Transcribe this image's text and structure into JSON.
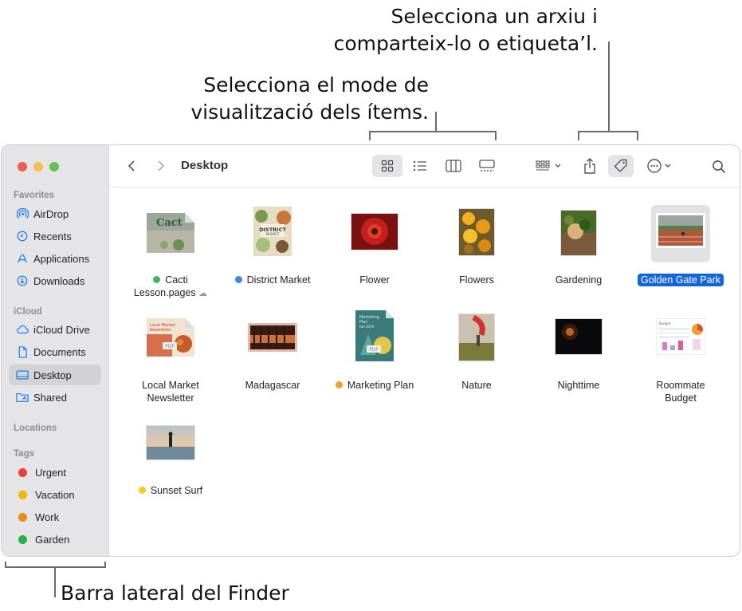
{
  "callouts": {
    "share_tag": "Selecciona un arxiu i\ncomparteix-lo o etiqueta’l.",
    "view_mode": "Selecciona el mode de\nvisualització dels ítems.",
    "sidebar": "Barra lateral del Finder"
  },
  "toolbar": {
    "title": "Desktop",
    "icons": [
      "chevron-left-icon",
      "chevron-right-icon",
      "icon-view-icon",
      "list-view-icon",
      "column-view-icon",
      "gallery-view-icon",
      "group-icon",
      "share-icon",
      "tag-icon",
      "more-icon",
      "search-icon"
    ]
  },
  "sidebar": {
    "favorites_label": "Favorites",
    "favorites": [
      {
        "label": "AirDrop",
        "icon": "airdrop-icon"
      },
      {
        "label": "Recents",
        "icon": "clock-icon"
      },
      {
        "label": "Applications",
        "icon": "applications-icon"
      },
      {
        "label": "Downloads",
        "icon": "download-icon"
      }
    ],
    "icloud_label": "iCloud",
    "icloud": [
      {
        "label": "iCloud Drive",
        "icon": "cloud-icon"
      },
      {
        "label": "Documents",
        "icon": "document-icon"
      },
      {
        "label": "Desktop",
        "icon": "desktop-icon",
        "selected": true
      },
      {
        "label": "Shared",
        "icon": "shared-folder-icon"
      }
    ],
    "locations_label": "Locations",
    "tags_label": "Tags",
    "tags": [
      {
        "label": "Urgent",
        "color": "#e8403a"
      },
      {
        "label": "Vacation",
        "color": "#f0b800"
      },
      {
        "label": "Work",
        "color": "#ee8a16"
      },
      {
        "label": "Garden",
        "color": "#27b04a"
      }
    ]
  },
  "files": [
    {
      "name": "Cacti\nLesson.pages",
      "tag": "#3dbb5c",
      "cloud": true,
      "thumb": "pages-doc"
    },
    {
      "name": "District Market",
      "tag": "#3d86e8",
      "thumb": "poster"
    },
    {
      "name": "Flower",
      "thumb": "flower"
    },
    {
      "name": "Flowers",
      "thumb": "flowers"
    },
    {
      "name": "Gardening",
      "thumb": "gardening"
    },
    {
      "name": "Golden Gate Park",
      "selected": true,
      "thumb": "track"
    },
    {
      "name": "Local Market\nNewsletter",
      "thumb": "pdf-newsletter"
    },
    {
      "name": "Madagascar",
      "thumb": "madagascar"
    },
    {
      "name": "Marketing Plan",
      "tag": "#f0a030",
      "thumb": "pdf-plan"
    },
    {
      "name": "Nature",
      "thumb": "nature"
    },
    {
      "name": "Nighttime",
      "thumb": "night"
    },
    {
      "name": "Roommate\nBudget",
      "thumb": "spreadsheet"
    },
    {
      "name": "Sunset Surf",
      "tag": "#f2cf1f",
      "thumb": "surf"
    }
  ]
}
